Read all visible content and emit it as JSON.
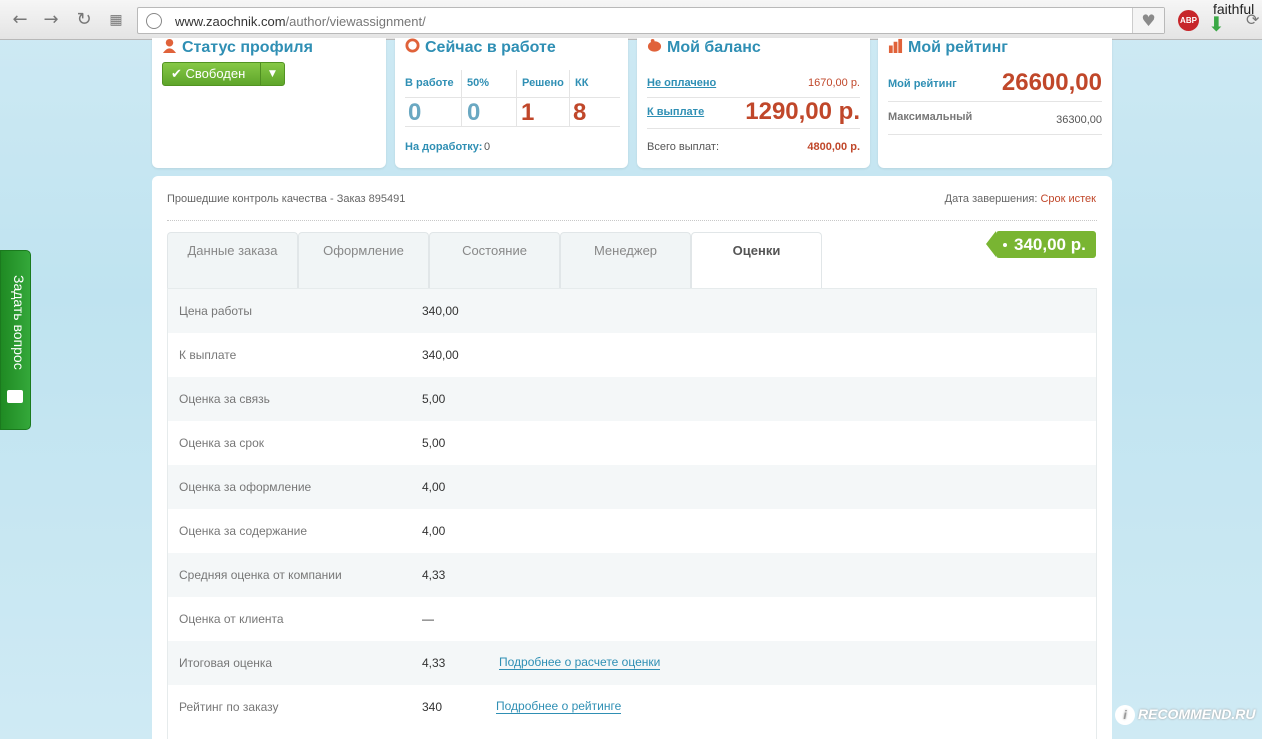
{
  "browser": {
    "url_host": "www.zaochnik.com",
    "url_path": "/author/viewassignment/",
    "abp_label": "ABP",
    "profile_name": "faithful"
  },
  "profile_status": {
    "title": "Статус профиля",
    "status_label": "Свободен"
  },
  "in_work": {
    "title": "Сейчас в работе",
    "cols": [
      {
        "label": "В работе",
        "value": "0",
        "color": "#6aa8c2"
      },
      {
        "label": "50%",
        "value": "0",
        "color": "#6aa8c2"
      },
      {
        "label": "Решено",
        "value": "1",
        "color": "#c0472a"
      },
      {
        "label": "КК",
        "value": "8",
        "color": "#c0472a"
      }
    ],
    "rework_label": "На доработку:",
    "rework_value": "0"
  },
  "balance": {
    "title": "Мой баланс",
    "unpaid_label": "Не оплачено",
    "unpaid_value": "1670,00 р.",
    "payout_label": "К выплате",
    "payout_value": "1290,00 р.",
    "total_label": "Всего выплат:",
    "total_value": "4800,00 р."
  },
  "rating": {
    "title": "Мой рейтинг",
    "my_label": "Мой рейтинг",
    "my_value": "26600,00",
    "max_label": "Максимальный",
    "max_value": "36300,00"
  },
  "order": {
    "qc_text": "Прошедшие контроль качества - Заказ 895491",
    "finish_label": "Дата завершения:",
    "finish_value": "Срок истек",
    "price": "340,00 р.",
    "tabs": [
      "Данные заказа",
      "Оформление",
      "Состояние",
      "Менеджер",
      "Оценки"
    ],
    "rows": [
      {
        "label": "Цена работы",
        "value": "340,00"
      },
      {
        "label": "К выплате",
        "value": "340,00"
      },
      {
        "label": "Оценка за связь",
        "value": "5,00"
      },
      {
        "label": "Оценка за срок",
        "value": "5,00"
      },
      {
        "label": "Оценка за оформление",
        "value": "4,00"
      },
      {
        "label": "Оценка за содержание",
        "value": "4,00"
      },
      {
        "label": "Средняя оценка от компании",
        "value": "4,33"
      },
      {
        "label": "Оценка от клиента",
        "value": "—"
      },
      {
        "label": "Итоговая оценка",
        "value": "4,33",
        "link": "Подробнее о расчете оценки"
      },
      {
        "label": "Рейтинг по заказу",
        "value": "340",
        "link": "Подробнее о рейтинге"
      }
    ]
  },
  "side_tab": {
    "label": "Задать вопрос"
  },
  "watermark": {
    "text": "RECOMMEND.RU"
  }
}
